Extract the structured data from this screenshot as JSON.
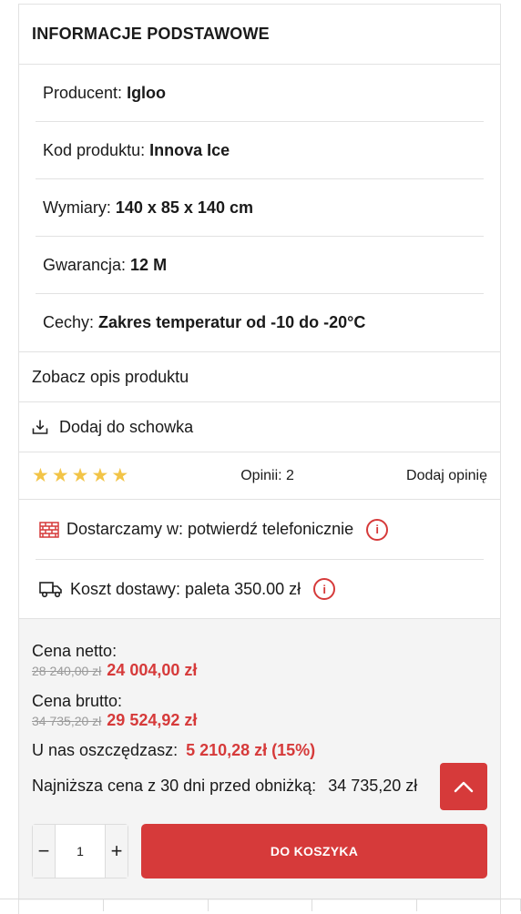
{
  "section": {
    "title": "INFORMACJE PODSTAWOWE"
  },
  "attributes": [
    {
      "label": "Producent:",
      "value": "Igloo"
    },
    {
      "label": "Kod produktu:",
      "value": "Innova Ice"
    },
    {
      "label": "Wymiary:",
      "value": "140 x 85 x 140 cm"
    },
    {
      "label": "Gwarancja:",
      "value": "12 M"
    },
    {
      "label": "Cechy:",
      "value": "Zakres temperatur od -10 do -20°C"
    }
  ],
  "links": {
    "description": "Zobacz opis produktu",
    "clipboard": "Dodaj do schowka"
  },
  "reviews": {
    "rating": 5,
    "count_text": "Opinii: 2",
    "add": "Dodaj opinię"
  },
  "delivery": {
    "deliver_to": "Dostarczamy w: potwierdź telefonicznie",
    "cost": "Koszt dostawy: paleta 350.00 zł"
  },
  "prices": {
    "net_label": "Cena netto:",
    "net_old": "28 240,00 zł",
    "net_new": "24 004,00 zł",
    "gross_label": "Cena brutto:",
    "gross_old": "34 735,20 zł",
    "gross_new": "29 524,92 zł",
    "save_label": "U nas oszczędzasz:",
    "save_value": "5 210,28 zł (15%)",
    "lowest_label": "Najniższa cena z 30 dni przed obniżką:",
    "lowest_value": "34 735,20 zł"
  },
  "cart": {
    "quantity": "1",
    "minus": "−",
    "plus": "+",
    "button": "DO KOSZYKA"
  },
  "colors": {
    "accent": "#d63a3a",
    "star": "#f2c447",
    "panel": "#f4f4f4"
  }
}
